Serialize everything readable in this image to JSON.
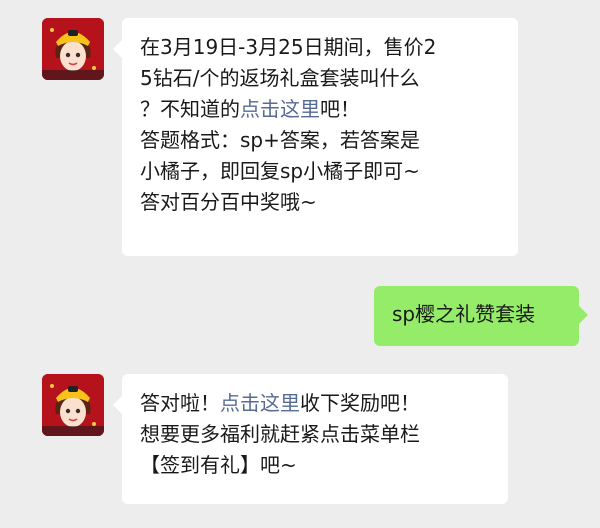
{
  "colors": {
    "background": "#ededed",
    "bubble_in": "#ffffff",
    "bubble_out": "#95ec69",
    "link": "#576b95",
    "text": "#191919"
  },
  "messages": [
    {
      "sender": "bot",
      "avatar_icon": "game-character-avatar",
      "lines": [
        [
          "在3月19日-3月25日期间，售价2"
        ],
        [
          "5钻石/个的返场礼盒套装叫什么"
        ],
        [
          "？不知道的",
          {
            "link": "点击这里"
          },
          "吧！"
        ],
        [
          "答题格式：sp+答案，若答案是"
        ],
        [
          "小橘子，即回复sp小橘子即可~"
        ],
        [
          "答对百分百中奖哦~"
        ]
      ]
    },
    {
      "sender": "user",
      "text": "sp樱之礼赞套装"
    },
    {
      "sender": "bot",
      "avatar_icon": "game-character-avatar",
      "lines": [
        [
          "答对啦！",
          {
            "link": "点击这里"
          },
          "收下奖励吧！"
        ],
        [
          "想要更多福利就赶紧点击菜单栏"
        ],
        [
          "【签到有礼】吧~"
        ]
      ]
    }
  ],
  "m1": {
    "l1": "在3月19日-3月25日期间，售价2",
    "l2": "5钻石/个的返场礼盒套装叫什么",
    "l3a": "？不知道的",
    "l3link": "点击这里",
    "l3b": "吧！",
    "l4": "答题格式：sp+答案，若答案是",
    "l5": "小橘子，即回复sp小橘子即可~",
    "l6": "答对百分百中奖哦~"
  },
  "m2": {
    "text": "sp樱之礼赞套装"
  },
  "m3": {
    "l1a": "答对啦！",
    "l1link": "点击这里",
    "l1b": "收下奖励吧！",
    "l2": "想要更多福利就赶紧点击菜单栏",
    "l3": "【签到有礼】吧~"
  }
}
